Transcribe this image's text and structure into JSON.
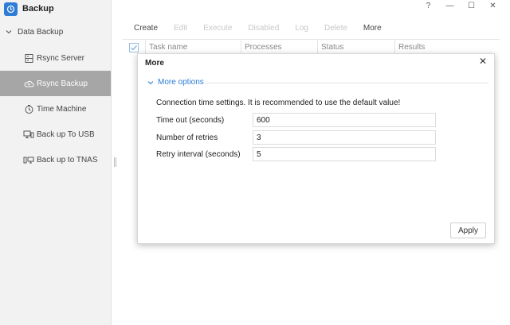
{
  "app": {
    "title": "Backup",
    "icon": "clock-backup-icon",
    "accent": "#2e7cd6"
  },
  "window_controls": {
    "help": "?",
    "minimize": "—",
    "maximize": "☐",
    "close": "✕"
  },
  "sidebar": {
    "group_label": "Data Backup",
    "items": [
      {
        "label": "Rsync Server",
        "icon": "server-icon"
      },
      {
        "label": "Rsync Backup",
        "icon": "cloud-sync-icon",
        "active": true
      },
      {
        "label": "Time Machine",
        "icon": "stopwatch-icon"
      },
      {
        "label": "Back up To USB",
        "icon": "monitor-usb-icon"
      },
      {
        "label": "Back up to TNAS",
        "icon": "device-monitor-icon"
      }
    ]
  },
  "toolbar": {
    "create": "Create",
    "edit": "Edit",
    "execute": "Execute",
    "disabled": "Disabled",
    "log": "Log",
    "delete": "Delete",
    "more": "More"
  },
  "table": {
    "columns": [
      "Task name",
      "Processes",
      "Status",
      "Results"
    ]
  },
  "dialog": {
    "title": "More",
    "section": "More options",
    "note": "Connection time settings. It is recommended to use the default value!",
    "fields": [
      {
        "label": "Time out (seconds)",
        "value": "600"
      },
      {
        "label": "Number of retries",
        "value": "3"
      },
      {
        "label": "Retry interval (seconds)",
        "value": "5"
      }
    ],
    "apply": "Apply",
    "close": "✕"
  }
}
